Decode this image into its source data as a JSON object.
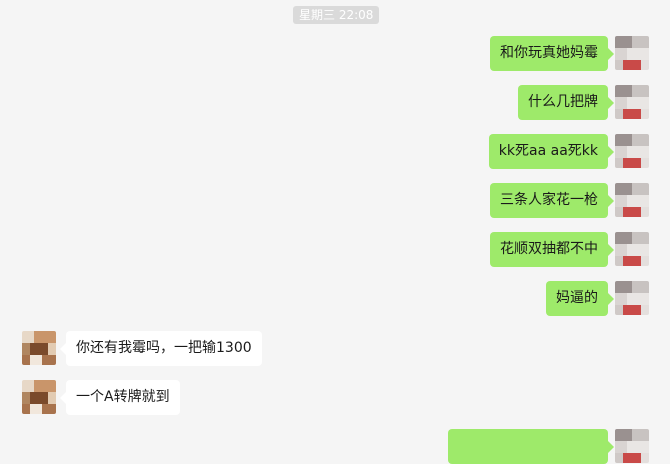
{
  "chat": {
    "timestamp": "星期三 22:08",
    "messages": [
      {
        "from": "me",
        "text": "和你玩真她妈霉"
      },
      {
        "from": "me",
        "text": "什么几把牌"
      },
      {
        "from": "me",
        "text": "kk死aa  aa死kk"
      },
      {
        "from": "me",
        "text": "三条人家花一枪"
      },
      {
        "from": "me",
        "text": "花顺双抽都不中"
      },
      {
        "from": "me",
        "text": "妈逼的"
      },
      {
        "from": "them",
        "text": "你还有我霉吗，一把输1300"
      },
      {
        "from": "them",
        "text": "一个A转牌就到"
      },
      {
        "from": "me",
        "text": ""
      }
    ]
  },
  "colors": {
    "background": "#f5f5f5",
    "outgoing_bubble": "#9eea6a",
    "incoming_bubble": "#ffffff",
    "time_pill": "#dadada"
  }
}
